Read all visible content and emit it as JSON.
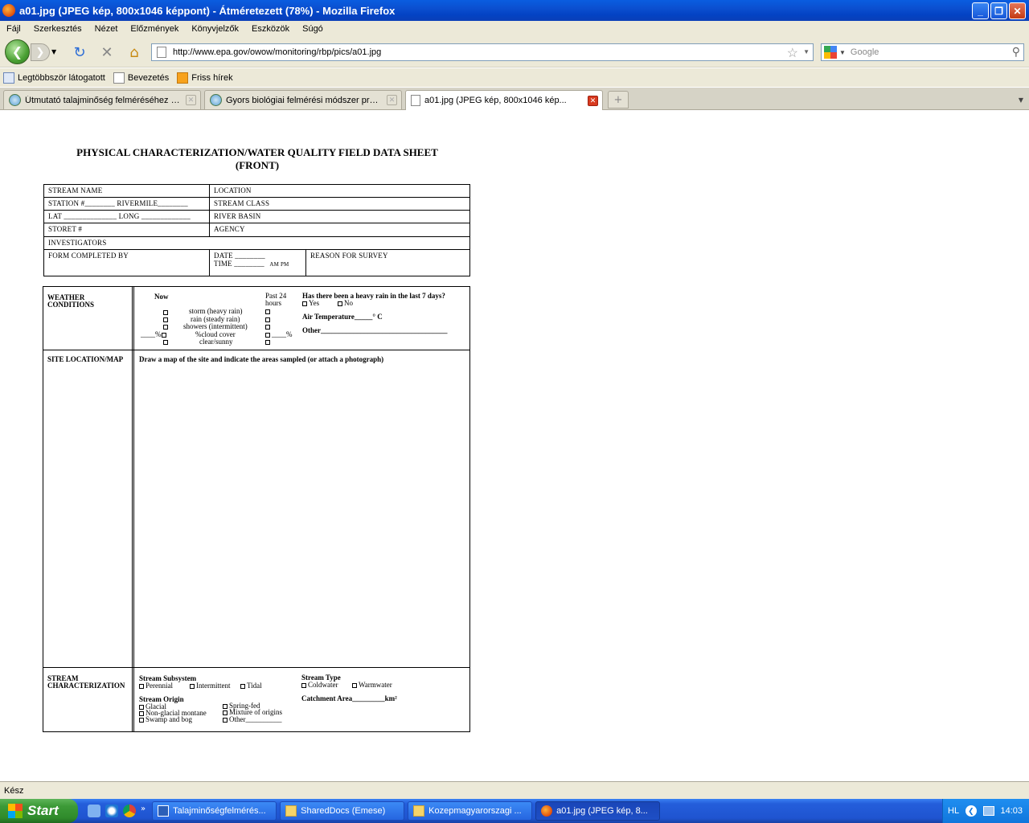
{
  "window": {
    "title": "a01.jpg (JPEG kép, 800x1046 képpont) - Átméretezett (78%) - Mozilla Firefox"
  },
  "menu": [
    "Fájl",
    "Szerkesztés",
    "Nézet",
    "Előzmények",
    "Könyvjelzők",
    "Eszközök",
    "Súgó"
  ],
  "url": "http://www.epa.gov/owow/monitoring/rbp/pics/a01.jpg",
  "search": {
    "placeholder": "Google"
  },
  "bookmarks": [
    "Legtöbbször látogatott",
    "Bevezetés",
    "Friss hírek"
  ],
  "tabs": [
    {
      "label": "Útmutató talajminőség felméréséhez m..."
    },
    {
      "label": "Gyors biológiai felmérési módszer prot..."
    },
    {
      "label": "a01.jpg (JPEG kép, 800x1046 kép..."
    }
  ],
  "doc": {
    "title1": "PHYSICAL CHARACTERIZATION/WATER QUALITY FIELD DATA SHEET",
    "title2": "(FRONT)",
    "stream_name": "STREAM NAME",
    "location": "LOCATION",
    "station": "STATION #________ RIVERMILE________",
    "stream_class": "STREAM CLASS",
    "latlong": "LAT ______________ LONG _____________",
    "river_basin": "RIVER BASIN",
    "storet": "STORET #",
    "agency": "AGENCY",
    "investigators": "INVESTIGATORS",
    "form_completed": "FORM COMPLETED BY",
    "date": "DATE ________",
    "time": "TIME ________",
    "am_pm": "AM   PM",
    "reason": "REASON FOR SURVEY",
    "weather": "WEATHER CONDITIONS",
    "now": "Now",
    "past24": "Past 24 hours",
    "conditions": [
      "storm (heavy rain)",
      "rain (steady rain)",
      "showers (intermittent)",
      "%cloud cover",
      "clear/sunny"
    ],
    "cloud_prefix": "____%",
    "cloud_suffix": "____%",
    "heavy_rain_q": "Has there been a heavy rain in the last 7 days?",
    "yes": "Yes",
    "no": "No",
    "air_temp": "Air Temperature_____° C",
    "other": "Other___________________________________",
    "site_location": "SITE LOCATION/MAP",
    "map_instruction": "Draw a map of the site and indicate the areas sampled (or attach a photograph)",
    "stream_char": "STREAM CHARACTERIZATION",
    "subsystem": "Stream Subsystem",
    "subsystem_opts": [
      "Perennial",
      "Intermittent",
      "Tidal"
    ],
    "stream_type": "Stream Type",
    "type_opts": [
      "Coldwater",
      "Warmwater"
    ],
    "origin": "Stream Origin",
    "origin_left": [
      "Glacial",
      "Non-glacial montane",
      "Swamp and bog"
    ],
    "origin_right": [
      "Spring-fed",
      "Mixture of origins",
      "Other__________"
    ],
    "catchment": "Catchment Area_________km²"
  },
  "status": "Kész",
  "taskbar": {
    "start": "Start",
    "buttons": [
      "Talajminőségfelmérés...",
      "SharedDocs (Emese)",
      "Kozepmagyarorszagi ...",
      "a01.jpg (JPEG kép, 8..."
    ],
    "lang": "HL",
    "clock": "14:03"
  }
}
